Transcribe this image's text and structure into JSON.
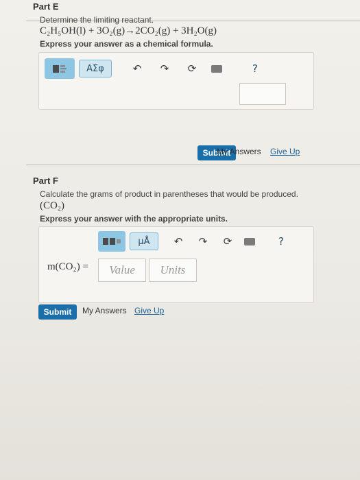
{
  "partE": {
    "title": "Part E",
    "instruction": "Determine the limiting reactant.",
    "equation": "C₂H₅OH(l) + 3O₂(g)→2CO₂(g) + 3H₂O(g)",
    "note": "Express your answer as a chemical formula.",
    "toolbar": {
      "symbol_label": "ΑΣφ",
      "icons": [
        "template-icon",
        "undo-icon",
        "redo-icon",
        "reset-icon",
        "keyboard-icon",
        "help-icon"
      ],
      "help_label": "?"
    },
    "answer_value": "",
    "submit_label": "Submit",
    "my_answers_label": "My Answers",
    "give_up_label": "Give Up"
  },
  "partF": {
    "title": "Part F",
    "instruction": "Calculate the grams of product in parentheses that would be produced.",
    "product": "(CO₂)",
    "note": "Express your answer with the appropriate units.",
    "toolbar": {
      "units_label": "μÅ",
      "help_label": "?"
    },
    "answer_label": "m(CO₂) =",
    "value_placeholder": "Value",
    "units_placeholder": "Units",
    "submit_label": "Submit",
    "my_answers_label": "My Answers",
    "give_up_label": "Give Up"
  },
  "colors": {
    "submit": "#1a6fa8",
    "toolbar_accent": "#8cc6e2",
    "link": "#1c6399"
  }
}
